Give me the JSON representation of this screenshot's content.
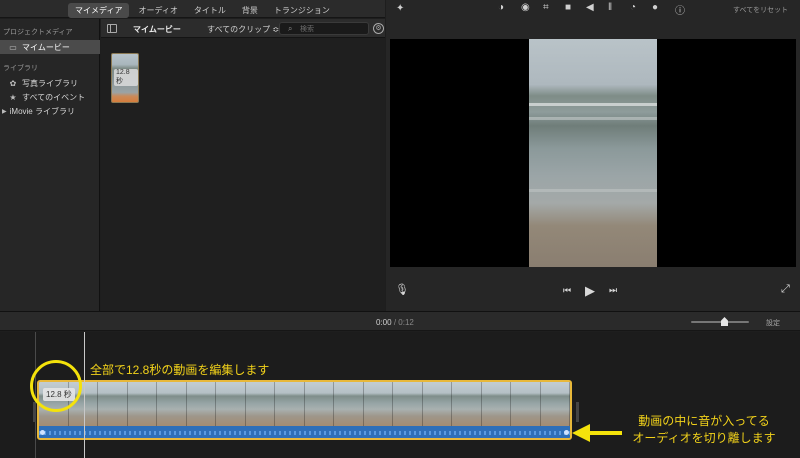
{
  "tabs": [
    "マイメディア",
    "オーディオ",
    "タイトル",
    "背景",
    "トランジション"
  ],
  "sidebar": {
    "section1": "プロジェクトメディア",
    "item_project": "マイムービー",
    "section2": "ライブラリ",
    "item_photos": "写真ライブラリ",
    "item_events": "すべてのイベント",
    "item_library": "iMovie ライブラリ"
  },
  "browser": {
    "title": "マイムービー",
    "clips_filter": "すべてのクリップ ≎",
    "search_placeholder": "検索",
    "thumb_duration": "12.8 秒"
  },
  "viewer": {
    "reset": "すべてをリセット",
    "icons": [
      "magic-wand-icon",
      "color-balance-icon",
      "color-palette-icon",
      "crop-icon",
      "stabilization-icon",
      "volume-icon",
      "noise-equalizer-icon",
      "speed-icon",
      "clip-filter-icon",
      "info-icon"
    ]
  },
  "timeline": {
    "current_time": "0:00",
    "separator": "/",
    "total_time": "0:12",
    "settings": "設定",
    "clip_duration": "12.8 秒"
  },
  "annotations": {
    "note1": "全部で12.8秒の動画を編集します",
    "note2_line1": "動画の中に音が入ってる",
    "note2_line2": "オーディオを切り離します"
  },
  "colors": {
    "accent_yellow": "#f4e20b",
    "clip_border": "#e8b83a",
    "audio_blue": "#2e6fb8"
  }
}
